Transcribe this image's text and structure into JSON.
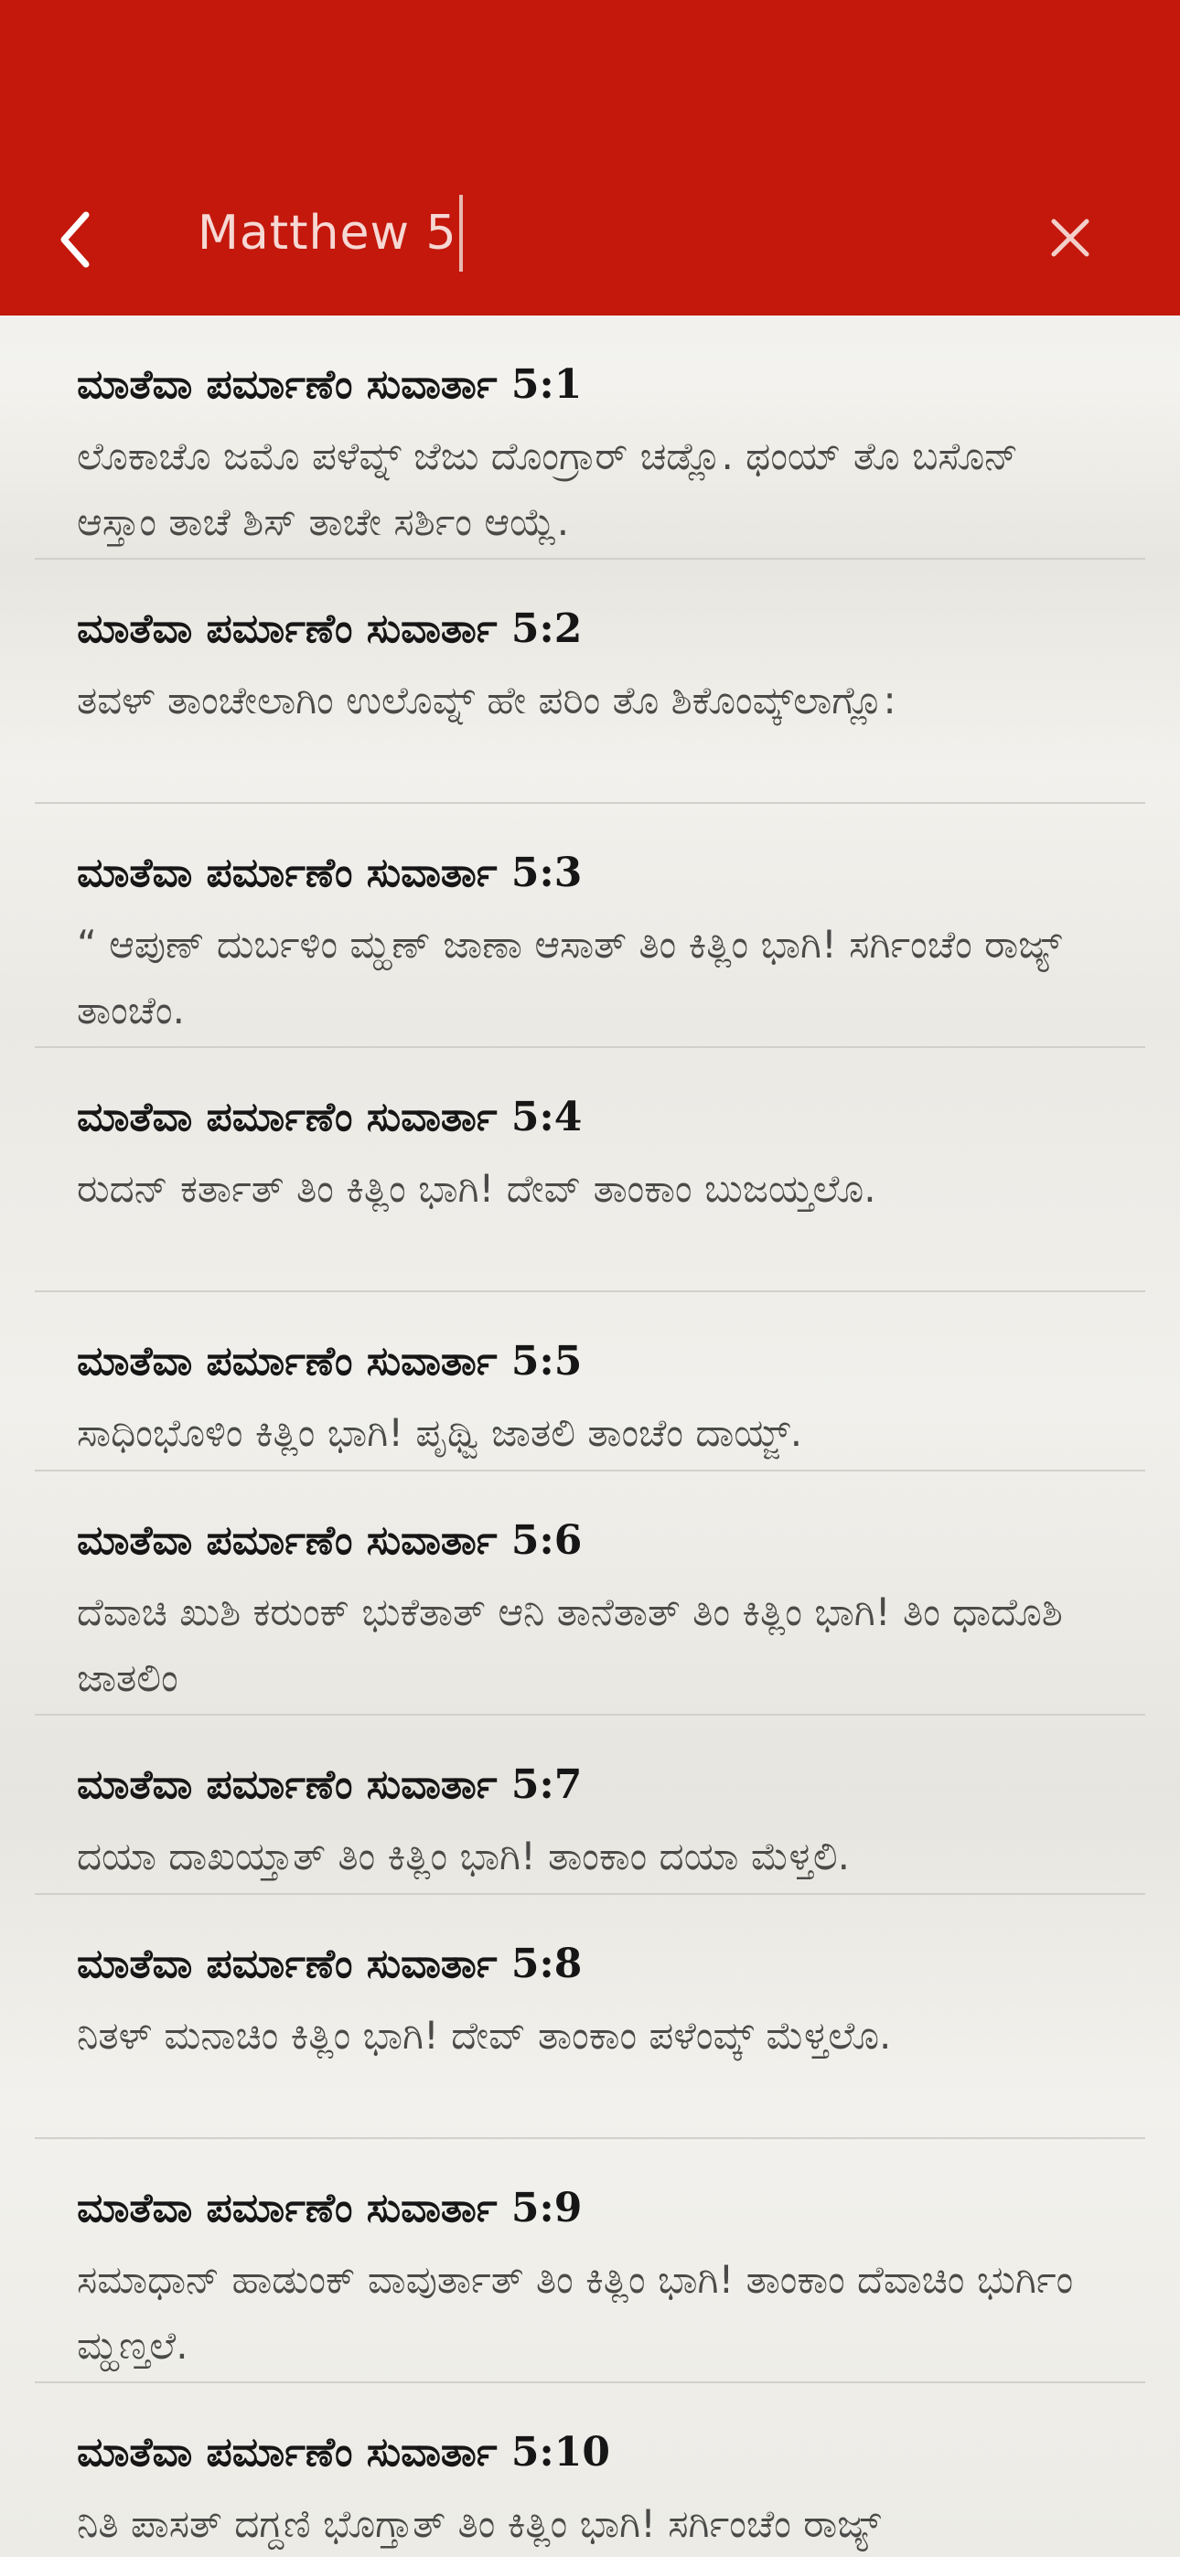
{
  "header": {
    "back_icon": "chevron-left-icon",
    "search_value": "Matthew 5",
    "clear_icon": "close-icon",
    "background_color": "#c4180c"
  },
  "results": [
    {
      "reference": "ಮಾತೆವಾ ಪರ್ಮಾಣೆಂ ಸುವಾರ್ತಾ 5:1",
      "text": "ಲೊಕಾಚೊ ಜಮೊ ಪಳೆವ್ನ್ ಜೆಜು ದೊಂಗ್ರಾರ್ ಚಡ್ಲೊ. ಥಂಯ್ ತೊ ಬಸೊನ್ ಆಸ್ತಾಂ ತಾಚೆ ಶಿಸ್ ತಾಚೇ ಸರ್ಶಿಂ ಆಯ್ಲೆ."
    },
    {
      "reference": "ಮಾತೆವಾ ಪರ್ಮಾಣೆಂ ಸುವಾರ್ತಾ 5:2",
      "text": "ತವಳ್ ತಾಂಚೇಲಾಗಿಂ ಉಲೊವ್ನ್ ಹೇ ಪರಿಂ ತೊ ಶಿಕೊಂವ್ಕ್‌ಲಾಗ್ಲೊ:"
    },
    {
      "reference": "ಮಾತೆವಾ ಪರ್ಮಾಣೆಂ ಸುವಾರ್ತಾ 5:3",
      "text": "“ ಆಪುಣ್ ದುರ್ಬಳಿಂ ಮ್ಹಣ್ ಜಾಣಾ ಆಸಾತ್ ತಿಂ ಕಿತ್ಲಿಂ ಭಾಗಿ! ಸರ್ಗಿಂಚೆಂ ರಾಜ್ಯ್ ತಾಂಚೆಂ."
    },
    {
      "reference": "ಮಾತೆವಾ ಪರ್ಮಾಣೆಂ ಸುವಾರ್ತಾ 5:4",
      "text": "ರುದನ್ ಕರ್ತಾತ್ ತಿಂ ಕಿತ್ಲಿಂ ಭಾಗಿ! ದೇವ್ ತಾಂಕಾಂ ಬುಜಯ್ತಲೊ."
    },
    {
      "reference": "ಮಾತೆವಾ ಪರ್ಮಾಣೆಂ ಸುವಾರ್ತಾ 5:5",
      "text": "ಸಾಧಿಂಭೊಳಿಂ ಕಿತ್ಲಿಂ ಭಾಗಿ! ಪೃಥ್ವಿ ಜಾತಲಿ ತಾಂಚೆಂ ದಾಯ್ಜ್."
    },
    {
      "reference": "ಮಾತೆವಾ ಪರ್ಮಾಣೆಂ ಸುವಾರ್ತಾ 5:6",
      "text": "ದೆವಾಚಿ ಖುಶಿ ಕರುಂಕ್ ಭುಕೆತಾತ್ ಆನಿ ತಾನೆತಾತ್ ತಿಂ ಕಿತ್ಲಿಂ ಭಾಗಿ! ತಿಂ ಧಾದೊಶಿ ಜಾತಲಿಂ"
    },
    {
      "reference": "ಮಾತೆವಾ ಪರ್ಮಾಣೆಂ ಸುವಾರ್ತಾ 5:7",
      "text": "ದಯಾ ದಾಖಯ್ತಾತ್ ತಿಂ ಕಿತ್ಲಿಂ ಭಾಗಿ! ತಾಂಕಾಂ ದಯಾ ಮೆಳ್ತಲಿ."
    },
    {
      "reference": "ಮಾತೆವಾ ಪರ್ಮಾಣೆಂ ಸುವಾರ್ತಾ 5:8",
      "text": "ನಿತಳ್ ಮನಾಚಿಂ ಕಿತ್ಲಿಂ ಭಾಗಿ! ದೇವ್ ತಾಂಕಾಂ ಪಳೆಂವ್ಕ್ ಮೆಳ್ತಲೊ."
    },
    {
      "reference": "ಮಾತೆವಾ ಪರ್ಮಾಣೆಂ ಸುವಾರ್ತಾ 5:9",
      "text": "ಸಮಾಧಾನ್ ಹಾಡುಂಕ್ ವಾವುರ್ತಾತ್ ತಿಂ ಕಿತ್ಲಿಂ ಭಾಗಿ! ತಾಂಕಾಂ ದೆವಾಚಿಂ ಭುರ್ಗಿಂ ಮ್ಹಣ್ತಲೆ."
    },
    {
      "reference": "ಮಾತೆವಾ ಪರ್ಮಾಣೆಂ ಸುವಾರ್ತಾ 5:10",
      "text": "ನಿತಿ ಪಾಸತ್ ದಗ್ದಣಿ ಭೊಗ್ತಾತ್ ತಿಂ ಕಿತ್ಲಿಂ ಭಾಗಿ! ಸರ್ಗಿಂಚೆಂ ರಾಜ್ಯ್"
    }
  ]
}
